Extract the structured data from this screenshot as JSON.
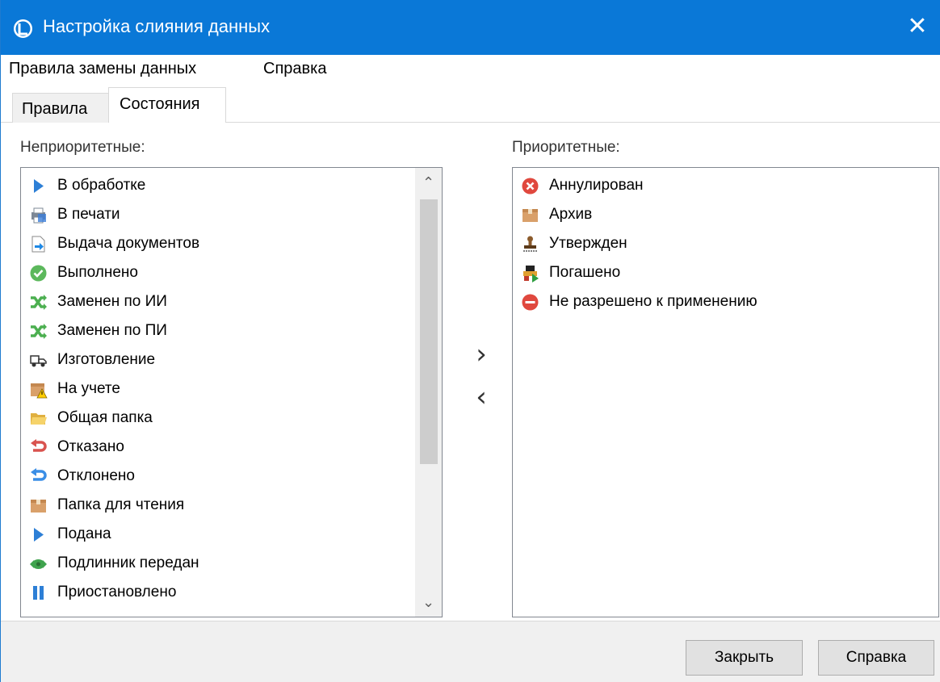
{
  "window": {
    "title": "Настройка слияния данных",
    "close_glyph": "✕"
  },
  "menu": {
    "items": [
      "Правила замены данных",
      "Справка"
    ]
  },
  "tabs": [
    "Правила",
    "Состояния"
  ],
  "active_tab": "Состояния",
  "left_panel": {
    "label": "Неприоритетные:",
    "items": [
      {
        "label": "В обработке",
        "icon": "play-arrow-icon"
      },
      {
        "label": "В печати",
        "icon": "printer-icon"
      },
      {
        "label": "Выдача документов",
        "icon": "document-arrow-icon"
      },
      {
        "label": "Выполнено",
        "icon": "check-circle-icon"
      },
      {
        "label": "Заменен по ИИ",
        "icon": "shuffle-icon"
      },
      {
        "label": "Заменен по ПИ",
        "icon": "shuffle-icon"
      },
      {
        "label": "Изготовление",
        "icon": "truck-icon"
      },
      {
        "label": "На учете",
        "icon": "box-warning-icon"
      },
      {
        "label": "Общая папка",
        "icon": "folder-open-icon"
      },
      {
        "label": "Отказано",
        "icon": "undo-red-icon"
      },
      {
        "label": "Отклонено",
        "icon": "undo-blue-icon"
      },
      {
        "label": "Папка для чтения",
        "icon": "box-icon"
      },
      {
        "label": "Подана",
        "icon": "play-arrow-icon"
      },
      {
        "label": "Подлинник передан",
        "icon": "transfer-icon"
      },
      {
        "label": "Приостановлено",
        "icon": "pause-icon"
      }
    ],
    "scroll_up_glyph": "⌃",
    "scroll_down_glyph": "⌄"
  },
  "right_panel": {
    "label": "Приоритетные:",
    "items": [
      {
        "label": "Аннулирован",
        "icon": "cancel-circle-icon"
      },
      {
        "label": "Архив",
        "icon": "box-icon"
      },
      {
        "label": "Утвержден",
        "icon": "stamp-icon"
      },
      {
        "label": "Погашено",
        "icon": "stamp-paid-icon"
      },
      {
        "label": "Не разрешено к применению",
        "icon": "no-entry-icon"
      }
    ]
  },
  "move_buttons": {
    "to_priority": "›",
    "to_non_priority": "‹"
  },
  "buttons": {
    "close": "Закрыть",
    "help": "Справка"
  },
  "colors": {
    "titlebar": "#0a78d7",
    "list_border": "#828790"
  }
}
